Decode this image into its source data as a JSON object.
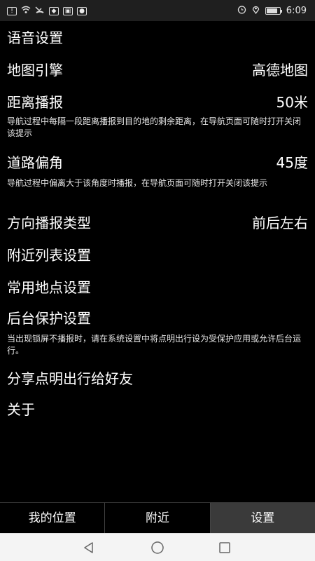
{
  "status_bar": {
    "left_icons": [
      "sim-notification-icon",
      "wifi-icon",
      "missed-call-icon",
      "app-icon-1",
      "app-icon-2",
      "app-icon-3"
    ],
    "right_icons": [
      "alarm-icon",
      "location-icon",
      "battery-icon"
    ],
    "battery_level": 0.85,
    "time": "6:09"
  },
  "settings": [
    {
      "title": "语音设置"
    },
    {
      "title": "地图引擎",
      "value": "高德地图"
    },
    {
      "title": "距离播报",
      "value": "50米",
      "desc": "导航过程中每隔一段距离播报到目的地的剩余距离，在导航页面可随时打开关闭该提示"
    },
    {
      "title": "道路偏角",
      "value": "45度",
      "desc": "导航过程中偏离大于该角度时播报，在导航页面可随时打开关闭该提示"
    },
    {
      "title": "方向播报类型",
      "value": "前后左右"
    },
    {
      "title": "附近列表设置"
    },
    {
      "title": "常用地点设置"
    },
    {
      "title": "后台保护设置",
      "desc": "当出现锁屏不播报时，请在系统设置中将点明出行设为受保护应用或允许后台运行。"
    },
    {
      "title": "分享点明出行给好友"
    },
    {
      "title": "关于"
    }
  ],
  "tabs": [
    {
      "label": "我的位置"
    },
    {
      "label": "附近"
    },
    {
      "label": "设置",
      "active": true
    }
  ],
  "colors": {
    "background": "#000000",
    "status_bar": "#1f1f1f",
    "active_tab": "#3a3a3a",
    "nav_bar": "#f4f4f4"
  }
}
